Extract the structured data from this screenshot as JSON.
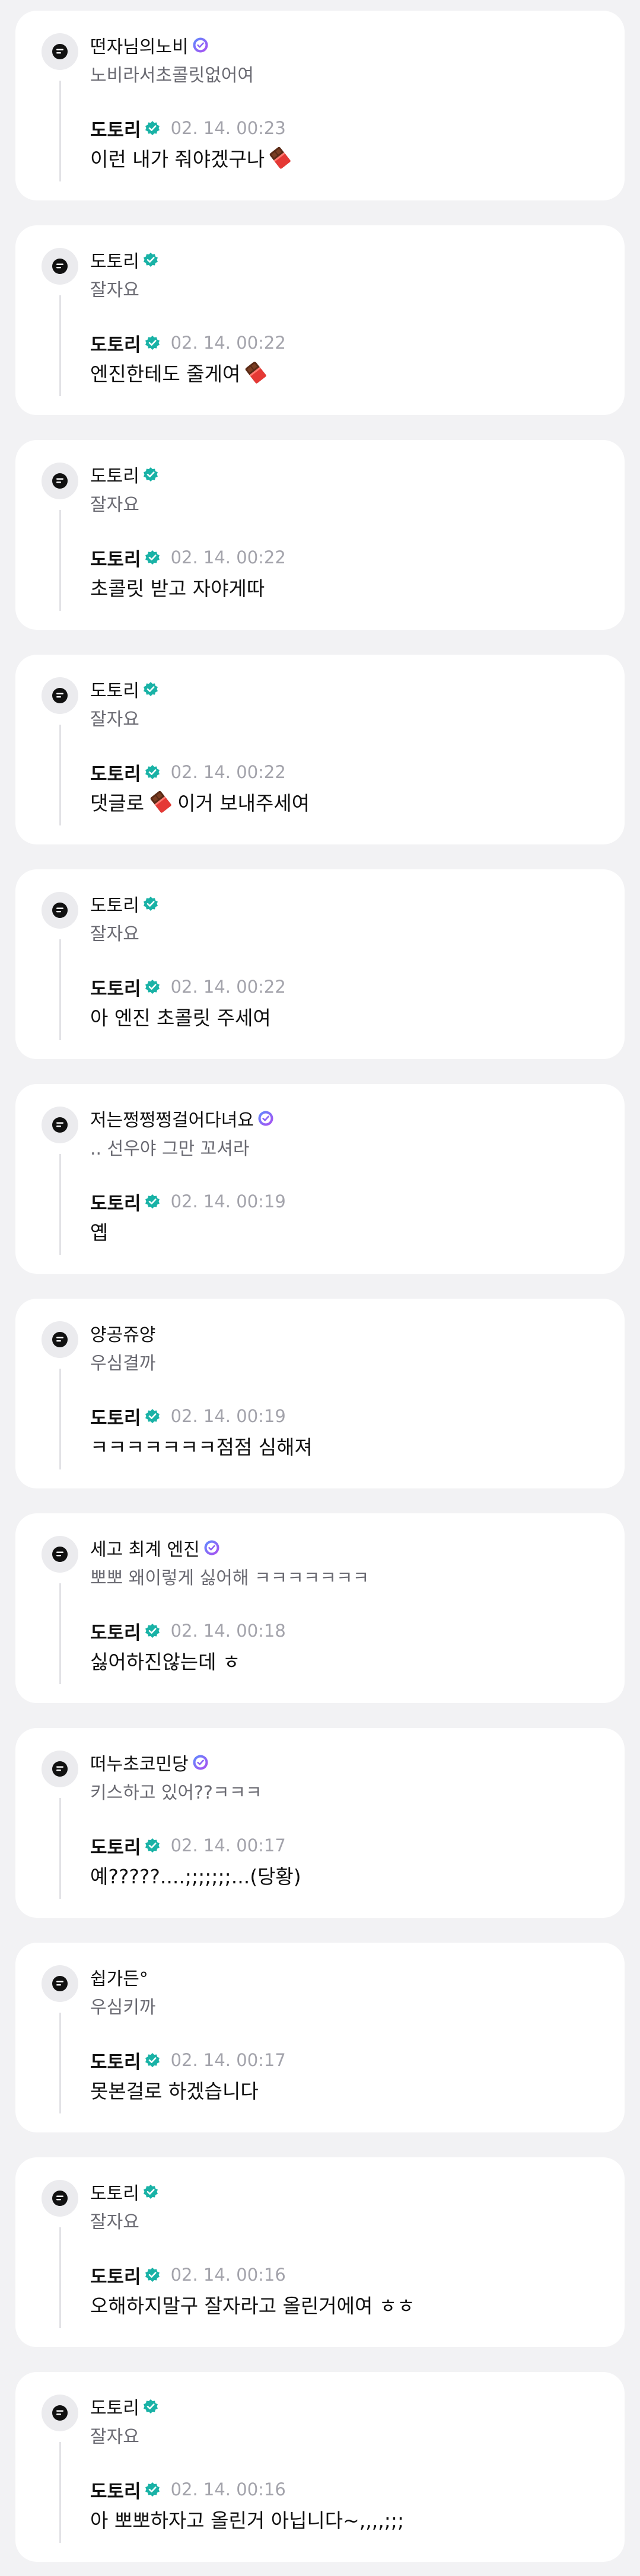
{
  "reply_author": "도토리",
  "cards": [
    {
      "parent_author": "떤자님의노비",
      "parent_badge": "purple",
      "parent_text": "노비라서초콜릿없어여",
      "reply_time": "02. 14. 00:23",
      "reply_pre": "이런 내가 줘야겠구나",
      "reply_emoji": "chocolate-icon",
      "reply_post": ""
    },
    {
      "parent_author": "도토리",
      "parent_badge": "teal",
      "parent_text": "잘자요",
      "reply_time": "02. 14. 00:22",
      "reply_pre": "엔진한테도 줄게여",
      "reply_emoji": "chocolate-icon",
      "reply_post": ""
    },
    {
      "parent_author": "도토리",
      "parent_badge": "teal",
      "parent_text": "잘자요",
      "reply_time": "02. 14. 00:22",
      "reply_pre": "초콜릿 받고 자야게따",
      "reply_emoji": "",
      "reply_post": ""
    },
    {
      "parent_author": "도토리",
      "parent_badge": "teal",
      "parent_text": "잘자요",
      "reply_time": "02. 14. 00:22",
      "reply_pre": "댓글로",
      "reply_emoji": "chocolate-icon",
      "reply_post": "이거 보내주세여"
    },
    {
      "parent_author": "도토리",
      "parent_badge": "teal",
      "parent_text": "잘자요",
      "reply_time": "02. 14. 00:22",
      "reply_pre": "아 엔진 초콜릿 주세여",
      "reply_emoji": "",
      "reply_post": ""
    },
    {
      "parent_author": "저는쩡쩡쩡걸어다녀요",
      "parent_badge": "purple",
      "parent_text": ".. 선우야 그만 꼬셔라",
      "reply_time": "02. 14. 00:19",
      "reply_pre": "옙",
      "reply_emoji": "",
      "reply_post": ""
    },
    {
      "parent_author": "양공쥬양",
      "parent_badge": "",
      "parent_text": "우심결까",
      "reply_time": "02. 14. 00:19",
      "reply_pre": "ㅋㅋㅋㅋㅋㅋㅋ점점 심해져",
      "reply_emoji": "",
      "reply_post": ""
    },
    {
      "parent_author": "세고 최계 엔진",
      "parent_badge": "purple",
      "parent_text": "뽀뽀 왜이렇게 싫어해 ㅋㅋㅋㅋㅋㅋㅋ",
      "reply_time": "02. 14. 00:18",
      "reply_pre": "싫어하진않는데 ㅎ",
      "reply_emoji": "",
      "reply_post": ""
    },
    {
      "parent_author": "떠누초코민당",
      "parent_badge": "purple",
      "parent_text": "키스하고 있어??ㅋㅋㅋ",
      "reply_time": "02. 14. 00:17",
      "reply_pre": "예?????....;;;;;;;...(당황)",
      "reply_emoji": "",
      "reply_post": ""
    },
    {
      "parent_author": "쉽가든°",
      "parent_badge": "",
      "parent_text": "우심키까",
      "reply_time": "02. 14. 00:17",
      "reply_pre": "못본걸로 하겠습니다",
      "reply_emoji": "",
      "reply_post": ""
    },
    {
      "parent_author": "도토리",
      "parent_badge": "teal",
      "parent_text": "잘자요",
      "reply_time": "02. 14. 00:16",
      "reply_pre": "오해하지말구 잘자라고 올린거에여 ㅎㅎ",
      "reply_emoji": "",
      "reply_post": ""
    },
    {
      "parent_author": "도토리",
      "parent_badge": "teal",
      "parent_text": "잘자요",
      "reply_time": "02. 14. 00:16",
      "reply_pre": "아 뽀뽀하자고 올린거 아닙니다~,,,,;;;",
      "reply_emoji": "",
      "reply_post": ""
    }
  ],
  "colors": {
    "background": "#f2f2f4",
    "card": "#ffffff",
    "verified_teal": "#19b2a6",
    "badge_purple": "#8b63f5",
    "timestamp": "#a3a3ab"
  }
}
